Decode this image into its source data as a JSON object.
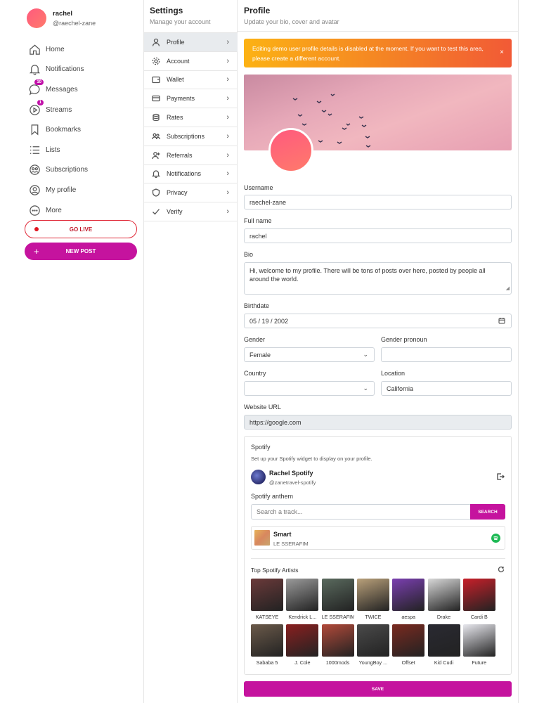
{
  "user": {
    "name": "rachel",
    "handle": "@raechel-zane"
  },
  "nav": {
    "items": [
      {
        "label": "Home",
        "icon": "home-icon",
        "badge": ""
      },
      {
        "label": "Notifications",
        "icon": "bell-icon",
        "badge": ""
      },
      {
        "label": "Messages",
        "icon": "message-icon",
        "badge": "10"
      },
      {
        "label": "Streams",
        "icon": "play-circle-icon",
        "badge": "1"
      },
      {
        "label": "Bookmarks",
        "icon": "bookmark-icon",
        "badge": ""
      },
      {
        "label": "Lists",
        "icon": "list-icon",
        "badge": ""
      },
      {
        "label": "Subscriptions",
        "icon": "subscriptions-icon",
        "badge": ""
      },
      {
        "label": "My profile",
        "icon": "user-circle-icon",
        "badge": ""
      },
      {
        "label": "More",
        "icon": "more-icon",
        "badge": ""
      }
    ],
    "go_live": "GO LIVE",
    "new_post": "NEW POST"
  },
  "settings": {
    "title": "Settings",
    "subtitle": "Manage your account",
    "items": [
      {
        "label": "Profile",
        "icon": "user-icon",
        "active": true
      },
      {
        "label": "Account",
        "icon": "gear-icon",
        "active": false
      },
      {
        "label": "Wallet",
        "icon": "wallet-icon",
        "active": false
      },
      {
        "label": "Payments",
        "icon": "credit-card-icon",
        "active": false
      },
      {
        "label": "Rates",
        "icon": "coins-icon",
        "active": false
      },
      {
        "label": "Subscriptions",
        "icon": "users-icon",
        "active": false
      },
      {
        "label": "Referrals",
        "icon": "user-plus-icon",
        "active": false
      },
      {
        "label": "Notifications",
        "icon": "bell-icon",
        "active": false
      },
      {
        "label": "Privacy",
        "icon": "shield-icon",
        "active": false
      },
      {
        "label": "Verify",
        "icon": "check-icon",
        "active": false
      }
    ]
  },
  "profile": {
    "title": "Profile",
    "subtitle": "Update your bio, cover and avatar",
    "alert": "Editing demo user profile details is disabled at the moment. If you want to test this area, please create a different account.",
    "alert_close": "×",
    "username_label": "Username",
    "username": "raechel-zane",
    "fullname_label": "Full name",
    "fullname": "rachel",
    "bio_label": "Bio",
    "bio": "Hi, welcome to my profile. There will be tons of posts over here, posted by people all around the world.",
    "birthdate_label": "Birthdate",
    "birthdate": "05 / 19 / 2002",
    "gender_label": "Gender",
    "gender": "Female",
    "pronoun_label": "Gender pronoun",
    "pronoun": "",
    "country_label": "Country",
    "country": "",
    "location_label": "Location",
    "location": "California",
    "website_label": "Website URL",
    "website": "https://google.com",
    "save": "SAVE"
  },
  "spotify": {
    "title": "Spotify",
    "description": "Set up your Spotify widget to display on your profile.",
    "account_name": "Rachel Spotify",
    "account_handle": "@zanetravel-spotify",
    "anthem_label": "Spotify anthem",
    "search_placeholder": "Search a track...",
    "search_button": "SEARCH",
    "track_title": "Smart",
    "track_artist": "LE SSERAFIM",
    "top_artists_title": "Top Spotify Artists",
    "artists": [
      {
        "name": "KATSEYE",
        "color": "#6b3a3a"
      },
      {
        "name": "Kendrick L...",
        "color": "#9a9a9a"
      },
      {
        "name": "LE SSERAFIM",
        "color": "#5a6a5e"
      },
      {
        "name": "TWICE",
        "color": "#b9a07a"
      },
      {
        "name": "aespa",
        "color": "#7a3fb0"
      },
      {
        "name": "Drake",
        "color": "#d8d8d8"
      },
      {
        "name": "Cardi B",
        "color": "#c8202a"
      },
      {
        "name": "Sababa 5",
        "color": "#6b5a4a"
      },
      {
        "name": "J. Cole",
        "color": "#8a2020"
      },
      {
        "name": "1000mods",
        "color": "#b24a3a"
      },
      {
        "name": "YoungBoy ...",
        "color": "#4a4a4a"
      },
      {
        "name": "Offset",
        "color": "#7a2a20"
      },
      {
        "name": "Kid Cudi",
        "color": "#2a2a32"
      },
      {
        "name": "Future",
        "color": "#e8e8ee"
      }
    ]
  },
  "colors": {
    "accent": "#c5139e",
    "live": "#e02b3a",
    "alert_start": "#fcb214",
    "alert_end": "#f25a36"
  }
}
